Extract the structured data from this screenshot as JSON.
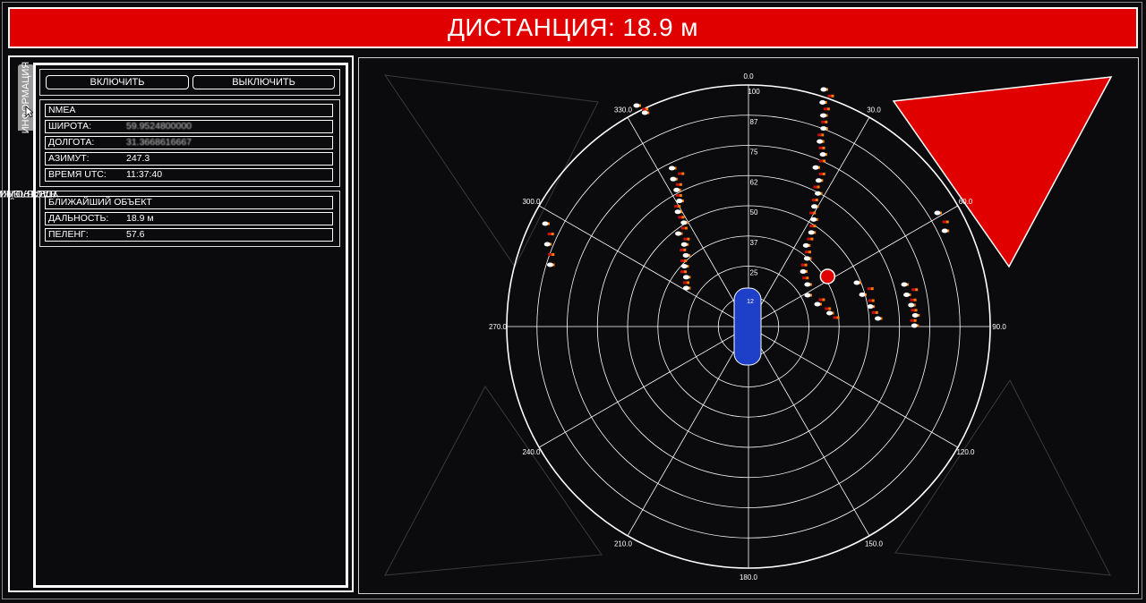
{
  "header": {
    "title": "ДИСТАНЦИЯ: 18.9 м"
  },
  "side_tabs": {
    "settings": "НАСТРОЙКИ",
    "control": "УПРАВЛЕНИЕ",
    "info": "ИНФОРМАЦИЯ"
  },
  "controls": {
    "enable_label": "ВКЛЮЧИТЬ",
    "disable_label": "ВЫКЛЮЧИТЬ"
  },
  "nmea": {
    "heading": "NMEA",
    "latitude_label": "ШИРОТА:",
    "latitude_value": "59.9524800000",
    "longitude_label": "ДОЛГОТА:",
    "longitude_value": "31.3668616667",
    "azimuth_label": "АЗИМУТ:",
    "azimuth_value": "247.3",
    "time_label": "ВРЕМЯ UTC:",
    "time_value": "11:37:40"
  },
  "nearest": {
    "heading": "БЛИЖАЙШИЙ ОБЪЕКТ",
    "range_label": "ДАЛЬНОСТЬ:",
    "range_value": "18.9 м",
    "bearing_label": "ПЕЛЕНГ:",
    "bearing_value": "57.6"
  },
  "radar": {
    "angle_labels": [
      "0.0",
      "30.0",
      "60.0",
      "90.0",
      "120.0",
      "150.0",
      "180.0",
      "210.0",
      "240.0",
      "270.0",
      "300.0",
      "330.0"
    ],
    "range_labels": [
      "100",
      "87",
      "75",
      "62",
      "50",
      "37",
      "25",
      "12",
      "0"
    ],
    "target_bearing_deg": 57.6,
    "target_range": 18.9,
    "colors": {
      "alert": "#e00000",
      "vehicle": "#1e3fc8",
      "grid": "#ffffff",
      "echo_hot": "#ffffff",
      "echo_mid": "#ff7a00",
      "echo_low": "#d01010"
    }
  }
}
